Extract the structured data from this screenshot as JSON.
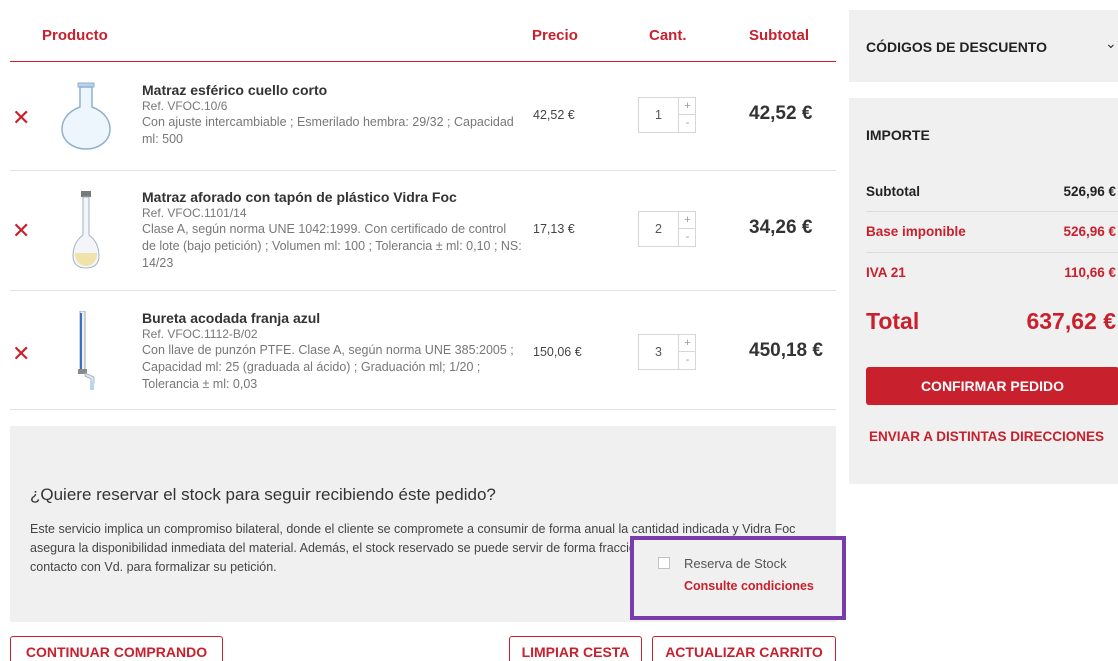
{
  "table": {
    "headers": {
      "product": "Producto",
      "price": "Precio",
      "qty": "Cant.",
      "subtotal": "Subtotal"
    },
    "remove_symbol": "✕",
    "items": [
      {
        "name": "Matraz esférico cuello corto",
        "ref": "Ref. VFOC.10/6",
        "desc": "Con ajuste intercambiable ; Esmerilado hembra: 29/32 ; Capacidad ml: 500",
        "price": "42,52 €",
        "qty": "1",
        "subtotal": "42,52 €",
        "icon": "round-flask-icon"
      },
      {
        "name": "Matraz aforado con tapón de plástico Vidra Foc",
        "ref": "Ref. VFOC.1101/14",
        "desc": "Clase A, según norma UNE 1042:1999. Con certificado de control de lote (bajo petición) ; Volumen ml: 100 ; Tolerancia ± ml: 0,10 ; NS: 14/23",
        "price": "17,13 €",
        "qty": "2",
        "subtotal": "34,26 €",
        "icon": "volumetric-flask-icon"
      },
      {
        "name": "Bureta acodada franja azul",
        "ref": "Ref. VFOC.1112-B/02",
        "desc": "Con llave de punzón PTFE. Clase A, según norma UNE 385:2005 ; Capacidad ml: 25 (graduada al ácido) ; Graduación ml; 1/20 ; Tolerancia ± ml: 0,03",
        "price": "150,06 €",
        "qty": "3",
        "subtotal": "450,18 €",
        "icon": "burette-icon"
      }
    ],
    "stepper": {
      "plus": "+",
      "minus": "-"
    }
  },
  "reserve": {
    "title": "¿Quiere reservar el stock para seguir recibiendo éste pedido?",
    "text": "Este servicio implica un compromiso bilateral, donde el cliente se compromete a consumir de forma anual la cantidad indicada y Vidra Foc asegura la disponibilidad inmediata del material. Además, el stock reservado se puede servir de forma fraccionada. Vidra Foc se pondrá en contacto con Vd. para formalizar su petición.",
    "checkbox_label": "Reserva de Stock",
    "conditions_link": "Consulte condiciones",
    "highlight_color": "#7a3bab"
  },
  "buttons": {
    "continue": "CONTINUAR COMPRANDO",
    "clear": "LIMPIAR CESTA",
    "update": "ACTUALIZAR CARRITO"
  },
  "discount": {
    "title": "CÓDIGOS DE DESCUENTO",
    "chevron": "⌄"
  },
  "summary": {
    "title": "IMPORTE",
    "rows": [
      {
        "label": "Subtotal",
        "value": "526,96 €",
        "color": "#222222"
      },
      {
        "label": "Base imponible",
        "value": "526,96 €",
        "color": "#c8202d"
      },
      {
        "label": "IVA 21",
        "value": "110,66 €",
        "color": "#c8202d"
      }
    ],
    "total_label": "Total",
    "total_value": "637,62 €",
    "confirm": "CONFIRMAR PEDIDO",
    "multi_address": "ENVIAR A DISTINTAS DIRECCIONES"
  },
  "colors": {
    "accent": "#c8202d",
    "panel": "#f0f0f0"
  }
}
